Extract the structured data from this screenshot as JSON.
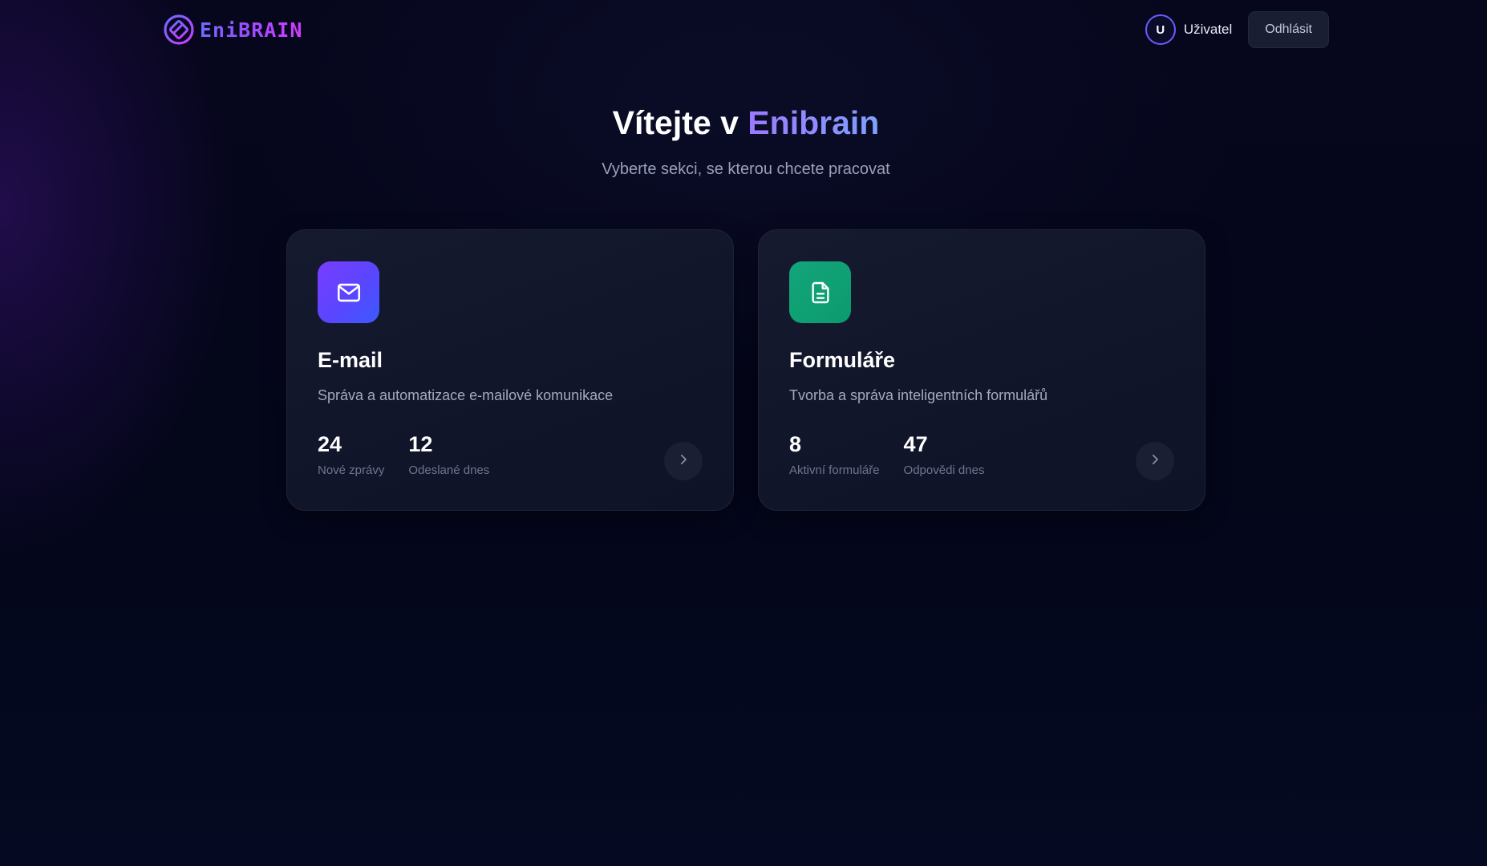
{
  "brand": {
    "name": "EniBRAIN",
    "logo_icon": "enibrain-logo-icon"
  },
  "header": {
    "user_initial": "U",
    "user_name": "Uživatel",
    "logout_label": "Odhlásit"
  },
  "hero": {
    "title_prefix": "Vítejte v",
    "title_accent": "Enibrain",
    "subtitle": "Vyberte sekci, se kterou chcete pracovat"
  },
  "cards": [
    {
      "icon": "mail-icon",
      "title": "E-mail",
      "description": "Správa a automatizace e-mailové komunikace",
      "stats": [
        {
          "value": "24",
          "label": "Nové zprávy"
        },
        {
          "value": "12",
          "label": "Odeslané dnes"
        }
      ],
      "accent": "#6a3cff"
    },
    {
      "icon": "document-icon",
      "title": "Formuláře",
      "description": "Tvorba a správa inteligentních formulářů",
      "stats": [
        {
          "value": "8",
          "label": "Aktivní formuláře"
        },
        {
          "value": "47",
          "label": "Odpovědi dnes"
        }
      ],
      "accent": "#0fa274"
    }
  ],
  "colors": {
    "background": "#05061a",
    "card_background": "#13172b",
    "brand_gradient_start": "#6d6cff",
    "brand_gradient_end": "#d23cff"
  }
}
